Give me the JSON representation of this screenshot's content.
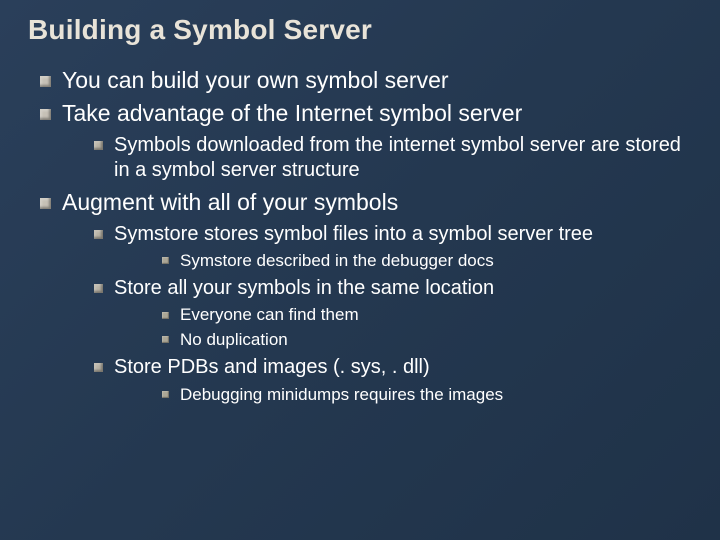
{
  "title": "Building a Symbol Server",
  "bullets": {
    "l1_0": "You can build your own symbol server",
    "l1_1": "Take advantage of the Internet symbol server",
    "l2_0": "Symbols downloaded from the internet symbol server are stored in a symbol server structure",
    "l1_2": "Augment with all of your symbols",
    "l2_1": "Symstore stores symbol files into a symbol server tree",
    "l3_0": "Symstore described in the debugger docs",
    "l2_2": "Store all your symbols in the same location",
    "l3_1": "Everyone can find them",
    "l3_2": "No duplication",
    "l2_3": "Store PDBs and images (. sys, . dll)",
    "l3_3": "Debugging minidumps requires the images"
  }
}
